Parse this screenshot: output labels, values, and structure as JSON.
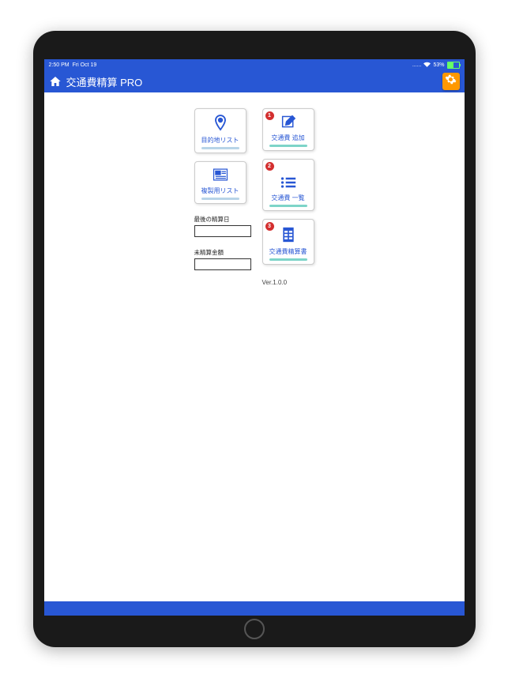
{
  "status": {
    "time": "2:50 PM",
    "date": "Fri Oct 19",
    "battery": "53%"
  },
  "header": {
    "title": "交通費精算 PRO"
  },
  "cards": {
    "destination": {
      "label": "目的地リスト"
    },
    "copy": {
      "label": "複製用リスト"
    },
    "add": {
      "label": "交通費 追加",
      "num": "1"
    },
    "list": {
      "label": "交通費 一覧",
      "num": "2"
    },
    "report": {
      "label": "交通費精算書",
      "num": "3"
    }
  },
  "fields": {
    "last_date": {
      "label": "最後の精算日",
      "value": ""
    },
    "pending": {
      "label": "未精算金額",
      "value": ""
    }
  },
  "version": "Ver.1.0.0"
}
